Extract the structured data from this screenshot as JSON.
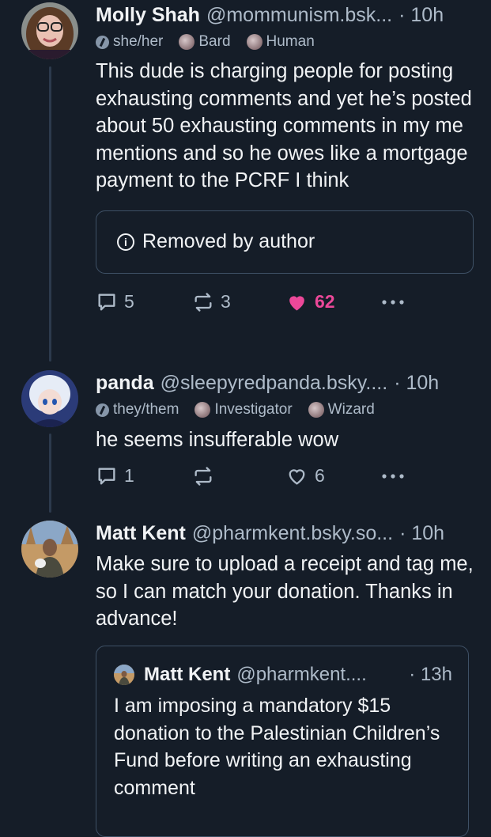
{
  "posts": [
    {
      "author": "Molly Shah",
      "handle": "@mommunism.bsk...",
      "time": "· 10h",
      "labels": [
        "she/her",
        "Bard",
        "Human"
      ],
      "text": "This dude is charging people for posting exhausting comments and yet he’s posted about 50 exhausting comments in my me mentions and so he owes like a mortgage payment to the PCRF I think",
      "embed_text": "Removed by author",
      "replies": "5",
      "reposts": "3",
      "likes": "62",
      "liked": true
    },
    {
      "author": "panda",
      "handle": "@sleepyredpanda.bsky....",
      "time": "· 10h",
      "labels": [
        "they/them",
        "Investigator",
        "Wizard"
      ],
      "text": "he seems insufferable wow",
      "replies": "1",
      "reposts": "",
      "likes": "6",
      "liked": false
    },
    {
      "author": "Matt Kent",
      "handle": "@pharmkent.bsky.so...",
      "time": "· 10h",
      "text": "Make sure to upload a receipt and tag me, so I can match your donation. Thanks in advance!",
      "quote": {
        "author": "Matt Kent",
        "handle": "@pharmkent....",
        "time": "· 13h",
        "text": "I am imposing a mandatory $15 donation to the Palestinian Children’s Fund before writing an exhausting comment"
      }
    }
  ],
  "icons": {
    "reply": "reply-icon",
    "repost": "repost-icon",
    "like": "heart-icon",
    "more": "more-icon",
    "info": "info-icon"
  },
  "colors": {
    "background": "#151d28",
    "like": "#ec4899",
    "muted": "#aebbc9",
    "border": "#3e5065"
  }
}
